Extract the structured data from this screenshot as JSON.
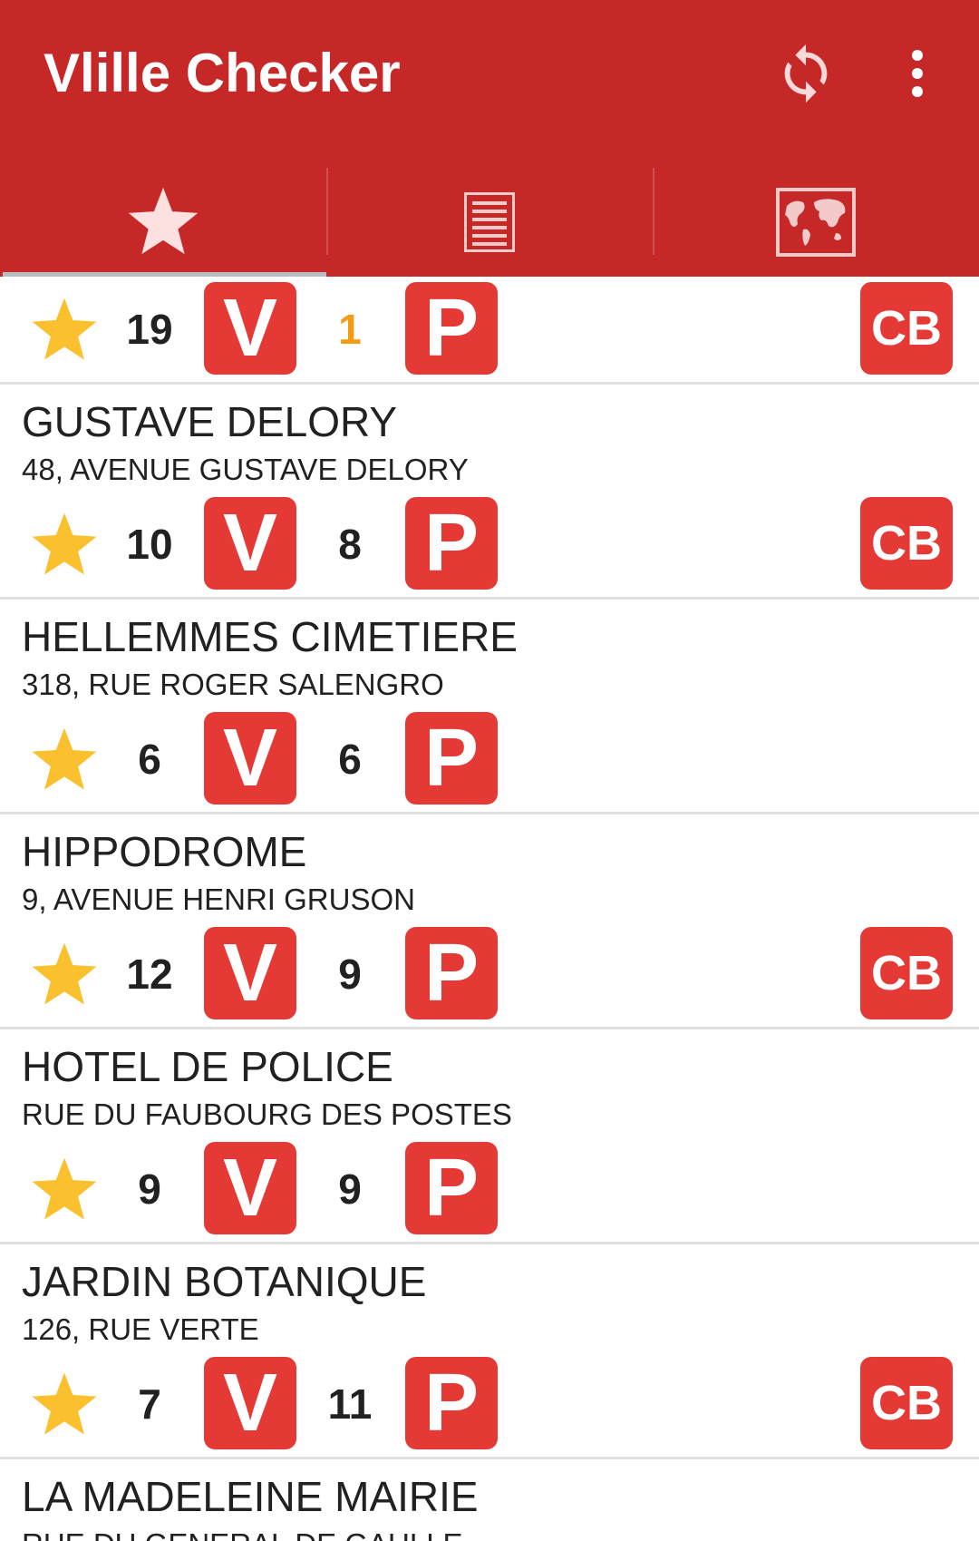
{
  "app": {
    "title": "Vlille Checker",
    "colors": {
      "primary": "#c62828",
      "badge": "#e53935",
      "star": "#fbc02d",
      "warning": "#f39c12"
    }
  },
  "toolbar": {
    "refresh_icon": "refresh-icon",
    "overflow_icon": "more-vert-icon"
  },
  "tabs": [
    {
      "icon": "star-icon",
      "selected": true
    },
    {
      "icon": "list-icon",
      "selected": false
    },
    {
      "icon": "map-icon",
      "selected": false
    }
  ],
  "stations": [
    {
      "name": "",
      "address": "",
      "bikes": "19",
      "stands": "1",
      "cb": "CB",
      "favorite": true
    },
    {
      "name": "GUSTAVE DELORY",
      "address": "48, AVENUE GUSTAVE DELORY",
      "bikes": "10",
      "stands": "8",
      "cb": "CB",
      "favorite": true
    },
    {
      "name": "HELLEMMES CIMETIERE",
      "address": "318, RUE ROGER SALENGRO",
      "bikes": "6",
      "stands": "6",
      "cb": "",
      "favorite": true
    },
    {
      "name": "HIPPODROME",
      "address": "9, AVENUE HENRI GRUSON",
      "bikes": "12",
      "stands": "9",
      "cb": "CB",
      "favorite": true
    },
    {
      "name": "HOTEL DE POLICE",
      "address": "RUE DU FAUBOURG DES POSTES",
      "bikes": "9",
      "stands": "9",
      "cb": "",
      "favorite": true
    },
    {
      "name": "JARDIN BOTANIQUE",
      "address": "126, RUE VERTE",
      "bikes": "7",
      "stands": "11",
      "cb": "CB",
      "favorite": true
    },
    {
      "name": "LA MADELEINE MAIRIE",
      "address": "RUE DU GENERAL DE GAULLE",
      "bikes": "",
      "stands": "",
      "cb": "",
      "favorite": true
    }
  ],
  "labels": {
    "bikes_badge": "V",
    "stands_badge": "P"
  }
}
